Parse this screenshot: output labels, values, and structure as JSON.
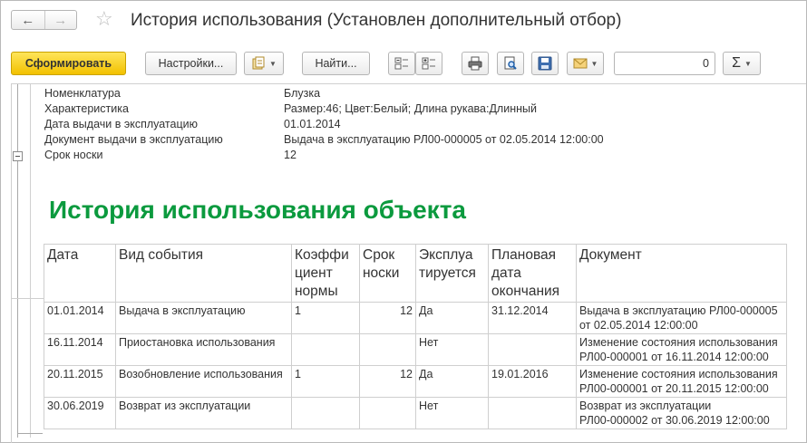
{
  "window": {
    "title": "История использования (Установлен дополнительный отбор)"
  },
  "nav": {
    "back_icon": "arrow-left-icon",
    "forward_icon": "arrow-right-icon"
  },
  "toolbar": {
    "generate_label": "Сформировать",
    "settings_label": "Настройки...",
    "find_label": "Найти...",
    "number_value": "0",
    "sum_symbol": "Σ"
  },
  "report": {
    "params": [
      {
        "label": "Номенклатура",
        "value": "Блузка"
      },
      {
        "label": "Характеристика",
        "value": "Размер:46; Цвет:Белый; Длина рукава:Длинный"
      },
      {
        "label": "Дата выдачи в эксплуатацию",
        "value": "01.01.2014"
      },
      {
        "label": "Документ выдачи в эксплуатацию",
        "value": "Выдача в эксплуатацию РЛ00-000005 от 02.05.2014 12:00:00"
      },
      {
        "label": "Срок носки",
        "value": "12"
      }
    ],
    "heading": "История использования объекта",
    "columns": [
      "Дата",
      "Вид события",
      "Коэффи\nциент\nнормы",
      "Срок\nноски",
      "Эксплуа\nтируется",
      "Плановая\nдата\nокончания",
      "Документ"
    ],
    "rows": [
      [
        "01.01.2014",
        "Выдача в эксплуатацию",
        "1",
        "12",
        "Да",
        "31.12.2014",
        "Выдача в эксплуатацию РЛ00-000005\nот 02.05.2014 12:00:00"
      ],
      [
        "16.11.2014",
        "Приостановка использования",
        "",
        "",
        "Нет",
        "",
        "Изменение состояния использования\nРЛ00-000001 от 16.11.2014 12:00:00"
      ],
      [
        "20.11.2015",
        "Возобновление использования",
        "1",
        "12",
        "Да",
        "19.01.2016",
        "Изменение состояния использования\nРЛ00-000001 от 20.11.2015 12:00:00"
      ],
      [
        "30.06.2019",
        "Возврат из эксплуатации",
        "",
        "",
        "Нет",
        "",
        "Возврат из эксплуатации\nРЛ00-000002 от 30.06.2019 12:00:00"
      ]
    ]
  },
  "colors": {
    "accent_yellow": "#f2c100",
    "heading_green": "#0b9a3e"
  }
}
